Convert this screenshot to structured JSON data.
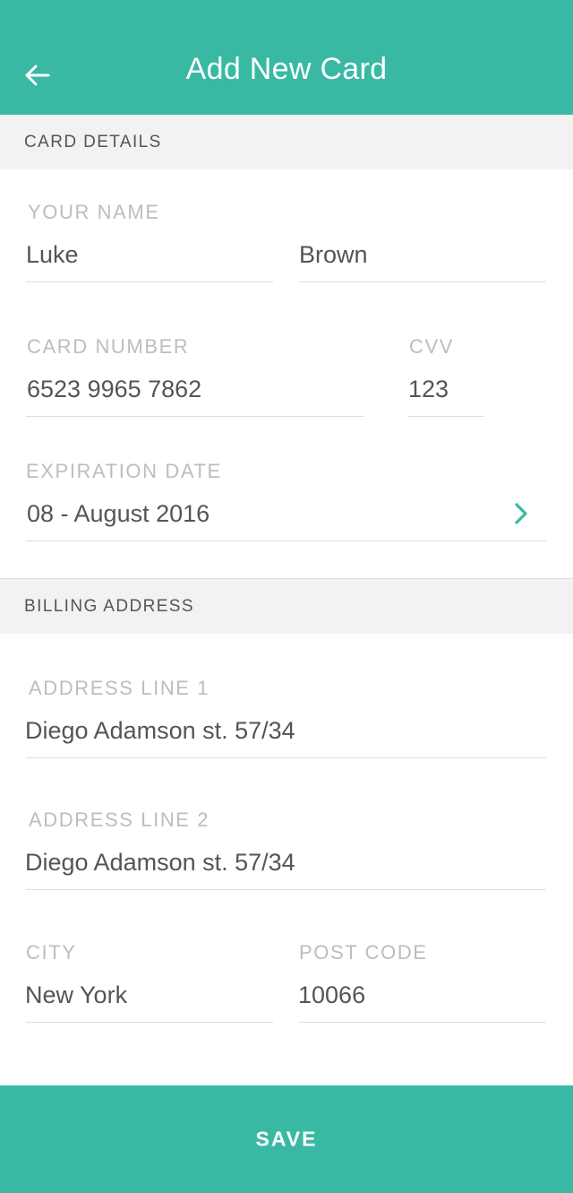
{
  "header": {
    "title": "Add New Card",
    "back_icon": "arrow-left-icon",
    "background_color": "#39b9a3"
  },
  "card_details": {
    "section_label": "CARD DETAILS",
    "name": {
      "label": "YOUR NAME",
      "first_value": "Luke",
      "last_value": "Brown"
    },
    "card_number": {
      "label": "CARD NUMBER",
      "value": "6523 9965 7862"
    },
    "cvv": {
      "label": "CVV",
      "value": "123"
    },
    "expiration": {
      "label": "EXPIRATION DATE",
      "value": "08 - August 2016",
      "icon": "chevron-right-icon"
    }
  },
  "billing_address": {
    "section_label": "BILLING ADDRESS",
    "address_line_1": {
      "label": "ADDRESS LINE 1",
      "value": "Diego Adamson st. 57/34"
    },
    "address_line_2": {
      "label": "ADDRESS LINE 2",
      "value": "Diego Adamson st. 57/34"
    },
    "city": {
      "label": "CITY",
      "value": "New York"
    },
    "post_code": {
      "label": "POST CODE",
      "value": "10066"
    }
  },
  "footer": {
    "save_label": "SAVE",
    "accent_color": "#39b9a3"
  }
}
